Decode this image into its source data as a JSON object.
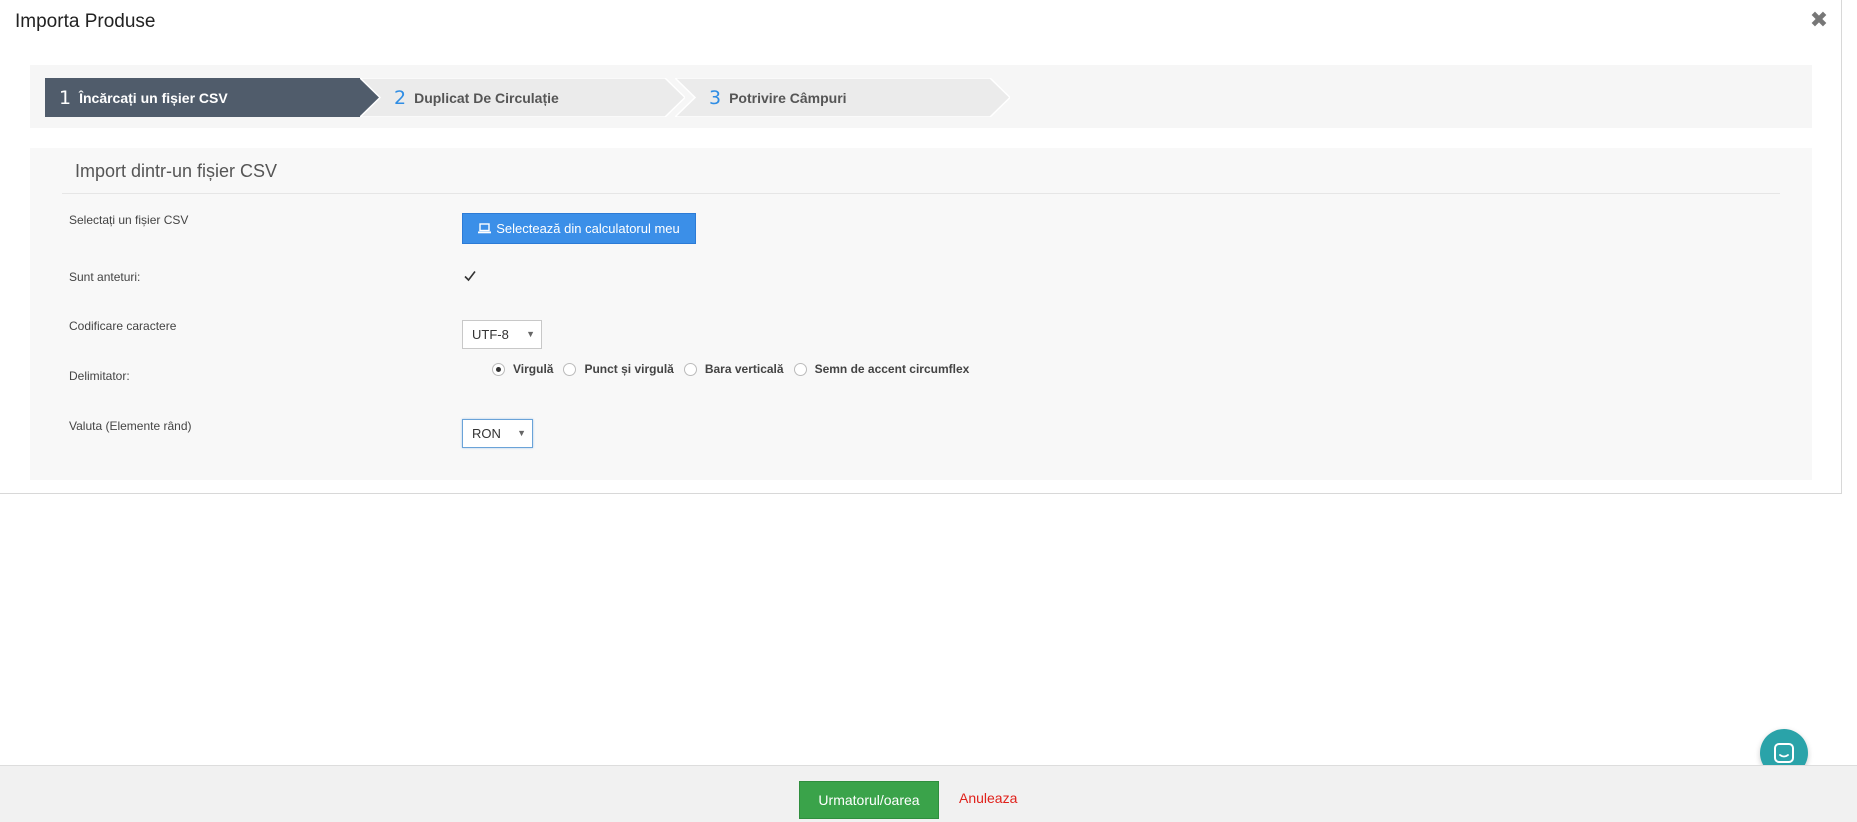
{
  "modal": {
    "title": "Importa Produse",
    "close_icon": "close-icon"
  },
  "wizard": {
    "steps": [
      {
        "number": "1",
        "label": "Încărcați un fișier CSV",
        "active": true
      },
      {
        "number": "2",
        "label": "Duplicat De Circulație",
        "active": false
      },
      {
        "number": "3",
        "label": "Potrivire Câmpuri",
        "active": false
      }
    ]
  },
  "panel": {
    "title": "Import dintr-un fișier CSV",
    "file": {
      "label": "Selectați un fișier CSV",
      "button_label": "Selectează din calculatorul meu",
      "button_icon": "laptop-icon"
    },
    "headers": {
      "label": "Sunt anteturi:",
      "checked": true
    },
    "encoding": {
      "label": "Codificare caractere",
      "value": "UTF-8"
    },
    "delimiter": {
      "label": "Delimitator:",
      "options": [
        {
          "label": "Virgulă",
          "selected": true
        },
        {
          "label": "Punct și virgulă",
          "selected": false
        },
        {
          "label": "Bara verticală",
          "selected": false
        },
        {
          "label": "Semn de accent circumflex",
          "selected": false
        }
      ]
    },
    "currency": {
      "label": "Valuta (Elemente rând)",
      "value": "RON"
    }
  },
  "footer": {
    "next_label": "Urmatorul/oarea",
    "cancel_label": "Anuleaza"
  },
  "colors": {
    "active_step": "#505c6b",
    "inactive_step": "#ebebeb",
    "step_number": "#2f8de4",
    "primary": "#3b8fe8",
    "success": "#3aa34a",
    "danger": "#e0211b",
    "chat": "#2aa3a9"
  },
  "chat": {
    "icon": "chat-icon"
  }
}
